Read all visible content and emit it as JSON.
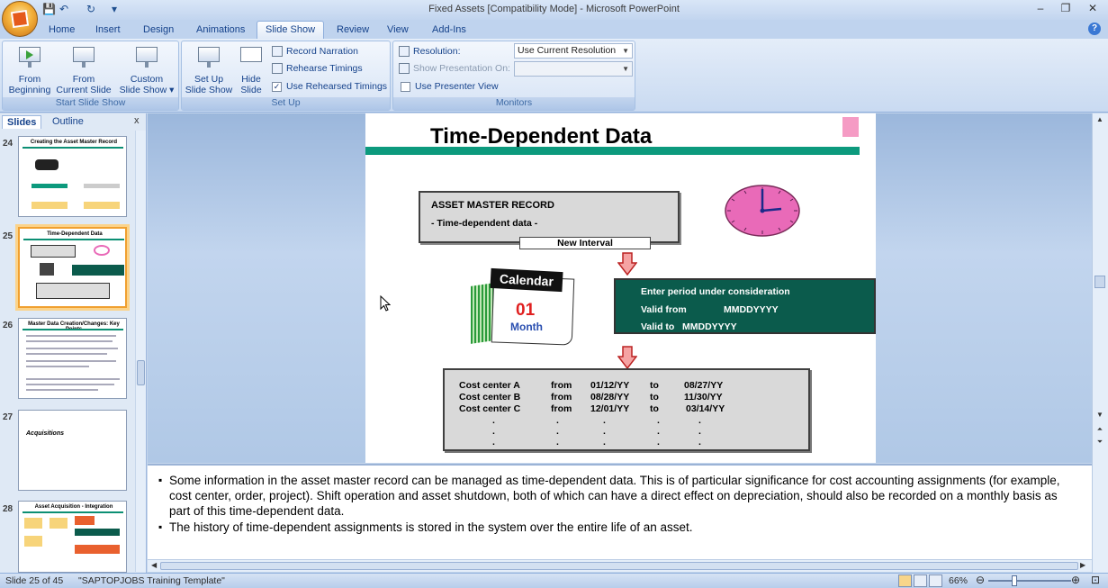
{
  "window": {
    "title": "Fixed Assets [Compatibility Mode] - Microsoft PowerPoint",
    "controls": [
      "–",
      "❐",
      "✕"
    ]
  },
  "qat": {
    "save": "💾",
    "undo": "↶",
    "redo": "↻",
    "more": "▾"
  },
  "tabs": [
    "Home",
    "Insert",
    "Design",
    "Animations",
    "Slide Show",
    "Review",
    "View",
    "Add-Ins"
  ],
  "active_tab": "Slide Show",
  "ribbon": {
    "start_group": {
      "label": "Start Slide Show",
      "from_beginning": "From\nBeginning",
      "from_current": "From\nCurrent Slide",
      "custom": "Custom\nSlide Show ▾"
    },
    "setup_group": {
      "label": "Set Up",
      "setup_show": "Set Up\nSlide Show",
      "hide_slide": "Hide\nSlide",
      "record_narration": "Record Narration",
      "rehearse_timings": "Rehearse Timings",
      "use_rehearsed": "Use Rehearsed Timings",
      "use_rehearsed_checked": true
    },
    "monitors_group": {
      "label": "Monitors",
      "resolution_label": "Resolution:",
      "resolution_value": "Use Current Resolution",
      "show_on_label": "Show Presentation On:",
      "show_on_value": "",
      "presenter_view": "Use Presenter View",
      "presenter_view_checked": false
    }
  },
  "left_pane": {
    "tabs": [
      "Slides",
      "Outline"
    ],
    "close": "x",
    "thumbnails": [
      {
        "num": "24",
        "title": "Creating the Asset Master Record"
      },
      {
        "num": "25",
        "title": "Time-Dependent Data"
      },
      {
        "num": "26",
        "title": "Master Data Creation/Changes: Key Points"
      },
      {
        "num": "27",
        "title": "Acquisitions"
      },
      {
        "num": "28",
        "title": "Asset Acquisition - Integration"
      }
    ],
    "selected": "25"
  },
  "slide": {
    "title": "Time-Dependent Data",
    "asset_master_heading": "ASSET MASTER RECORD",
    "asset_master_sub": "- Time-dependent  data -",
    "new_interval": "New Interval",
    "calendar_title": "Calendar",
    "calendar_day": "01",
    "calendar_month": "Month",
    "period": {
      "line1": "Enter period under  consideration",
      "valid_from_label": "Valid from",
      "valid_from_value": "MMDDYYYY",
      "valid_to_label": "Valid to",
      "valid_to_value": "MMDDYYYY"
    },
    "cost_centers": [
      {
        "name": "Cost center  A",
        "from": "from",
        "start": "01/12/YY",
        "to": "to",
        "end": "08/27/YY"
      },
      {
        "name": "Cost center  B",
        "from": "from",
        "start": "08/28/YY",
        "to": "to",
        "end": "11/30/YY"
      },
      {
        "name": "Cost center  C",
        "from": "from",
        "start": "12/01/YY",
        "to": "to",
        "end": "03/14/YY"
      }
    ],
    "dot": "."
  },
  "notes": [
    "Some information in the asset master record can be managed as time-dependent data.  This is of particular significance for cost accounting assignments (for example, cost center, order, project).  Shift operation and asset shutdown, both of which can have a direct effect on depreciation, should also be recorded on a monthly basis as part of this time-dependent data.",
    "The history of time-dependent assignments is stored in the system over the entire life of an asset."
  ],
  "status": {
    "slide_info": "Slide 25 of 45",
    "template": "\"SAPTOPJOBS Training Template\"",
    "zoom": "66%",
    "zoom_fraction": 0.66
  },
  "colors": {
    "accent_teal": "#0c9a7d",
    "period_box": "#0b5b4c",
    "pink_marker": "#f59bc4",
    "clock": "#e96ab8"
  }
}
